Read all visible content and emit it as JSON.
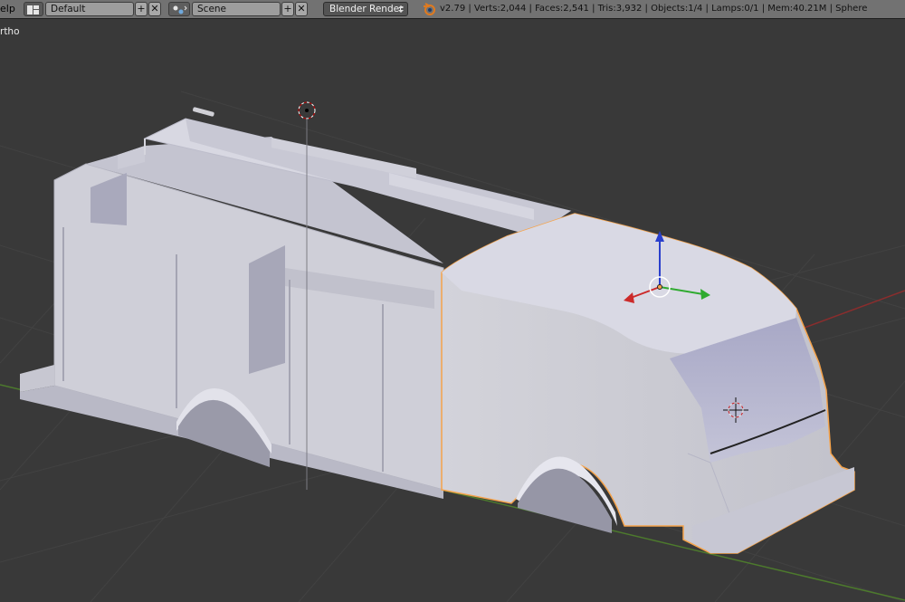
{
  "header": {
    "menu_label": "elp",
    "layout_name": "Default",
    "scene_name": "Scene",
    "render_engine": "Blender Render",
    "stats": "v2.79 | Verts:2,044 | Faces:2,541 | Tris:3,932 | Objects:1/4 | Lamps:0/1 | Mem:40.21M | Sphere",
    "add_symbol": "+",
    "close_symbol": "✕"
  },
  "viewport": {
    "view_label": "rtho"
  },
  "colors": {
    "header_bg": "#727272",
    "viewport_bg": "#393939",
    "grid": "#424242",
    "x_axis": "#8a2d2d",
    "y_axis": "#4d7a2d",
    "selection_outline": "#f5a34b",
    "mesh_face": "#c9c9d6"
  },
  "icons": [
    "screen-layout-icon",
    "scene-icon",
    "blender-logo-icon",
    "3d-cursor-icon",
    "transform-manipulator-icon",
    "object-origin-icon"
  ]
}
